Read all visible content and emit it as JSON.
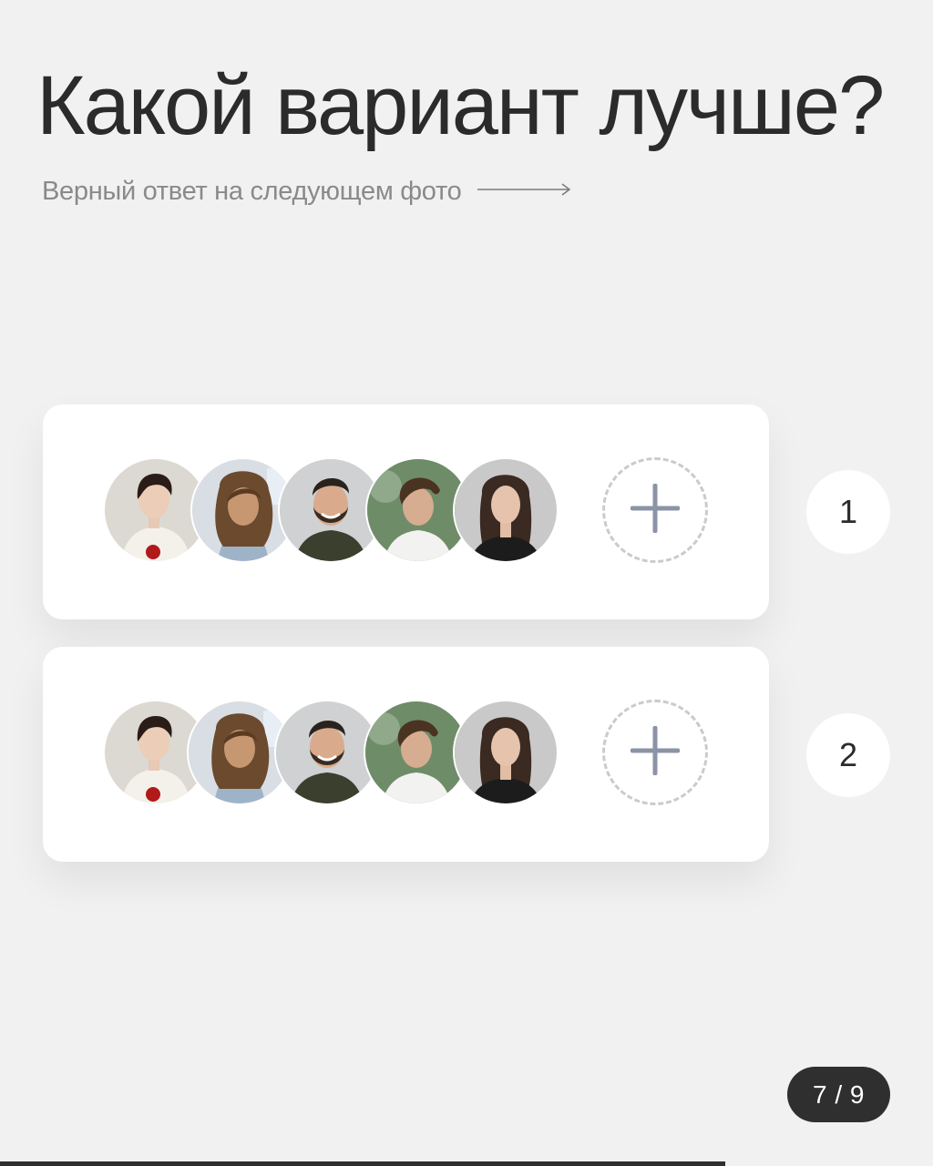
{
  "title": "Какой вариант лучше?",
  "subtitle": "Верный ответ на следующем фото",
  "options": [
    {
      "number": "1",
      "avatars": [
        "woman-dark-hair-bun",
        "woman-long-wavy-hair",
        "man-beard-smiling",
        "man-young-tousled-hair",
        "woman-long-dark-hair"
      ]
    },
    {
      "number": "2",
      "avatars": [
        "woman-dark-hair-bun",
        "woman-long-wavy-hair",
        "man-beard-smiling",
        "man-young-tousled-hair",
        "woman-long-dark-hair"
      ]
    }
  ],
  "pager": {
    "text": "7 / 9",
    "current": 7,
    "total": 9
  },
  "progress": {
    "fraction": 0.777
  },
  "colors": {
    "background": "#f1f1f1",
    "card": "#ffffff",
    "title": "#2b2b2b",
    "subtitle": "#8a8a8a",
    "plus": "#8b93a7",
    "dashed_border": "#c9cbd0",
    "pager_bg": "#2f2f2f"
  },
  "icons": {
    "arrow": "arrow-right-icon",
    "add": "plus-icon"
  }
}
